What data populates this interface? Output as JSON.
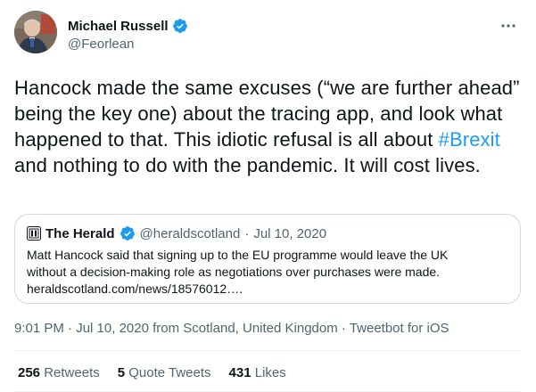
{
  "author": {
    "name": "Michael Russell",
    "handle": "@Feorlean"
  },
  "tweet": {
    "text_before": "Hancock made the same excuses (“we are further ahead” being the key one) about the tracing app, and look what happened to that. This idiotic refusal is all about ",
    "hashtag": "#Brexit",
    "text_after": " and nothing to do with the pandemic.  It will cost lives."
  },
  "quote": {
    "name": "The Herald",
    "handle": "@heraldscotland",
    "separator": "·",
    "date": "Jul 10, 2020",
    "text_line1": "Matt Hancock said that signing up to the EU programme would leave the UK",
    "text_line2": "without a decision-making role as negotiations over purchases were made.",
    "text_line3": "heraldscotland.com/news/18576012…."
  },
  "meta": {
    "time": "9:01 PM",
    "separator": "·",
    "date_location": "Jul 10, 2020 from Scotland, United Kingdom",
    "client": "Tweetbot for iOS"
  },
  "stats": {
    "retweets_count": "256",
    "retweets_label": "Retweets",
    "quotes_count": "5",
    "quotes_label": "Quote Tweets",
    "likes_count": "431",
    "likes_label": "Likes"
  },
  "icons": {
    "verified": "verified-badge-icon",
    "more": "more-options-icon"
  },
  "colors": {
    "accent": "#1d9bf0",
    "secondary_text": "#536471",
    "border": "#cfd9de"
  }
}
